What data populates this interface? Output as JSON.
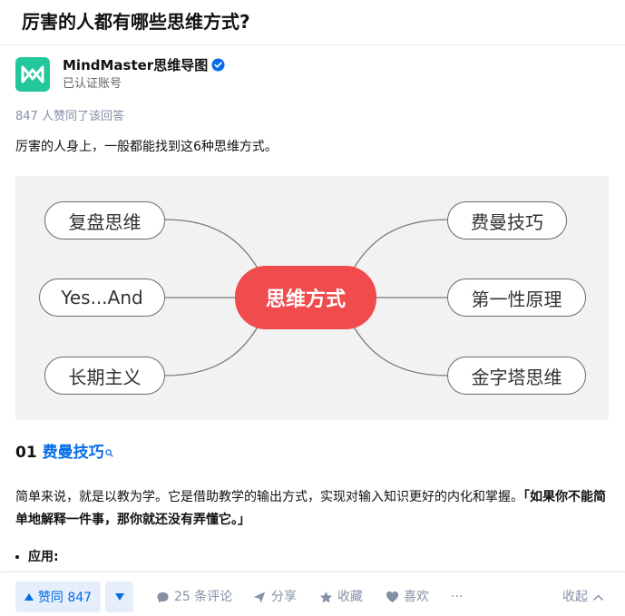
{
  "question": {
    "title": "厉害的人都有哪些思维方式?"
  },
  "author": {
    "name": "MindMaster思维导图",
    "subtitle": "已认证账号",
    "avatar_icon": "mindmaster-logo-icon",
    "verified_icon": "verified-badge-icon",
    "brand_color": "#22c79b"
  },
  "answer": {
    "votes_line": "847 人赞同了该回答",
    "intro": "厉害的人身上，一般都能找到这6种思维方式。",
    "mindmap": {
      "center": "思维方式",
      "left": [
        "复盘思维",
        "Yes...And",
        "长期主义"
      ],
      "right": [
        "费曼技巧",
        "第一性原理",
        "金字塔思维"
      ]
    },
    "section": {
      "number": "01",
      "title": "费曼技巧",
      "search_icon": "search-mini-icon"
    },
    "paragraph_plain": "简单来说，就是以教为学。它是借助教学的输出方式，实现对输入知识更好的内化和掌握。",
    "paragraph_bold": "「如果你不能简单地解释一件事，那你就还没有弄懂它。」",
    "bullet": "应用:"
  },
  "actions": {
    "vote_up": "赞同 847",
    "comments": "25 条评论",
    "share": "分享",
    "favorite": "收藏",
    "like": "喜欢",
    "more": "···",
    "collapse": "收起"
  },
  "colors": {
    "accent": "#056de8",
    "mindmap_center": "#f04b4d",
    "muted": "#8590a6"
  }
}
